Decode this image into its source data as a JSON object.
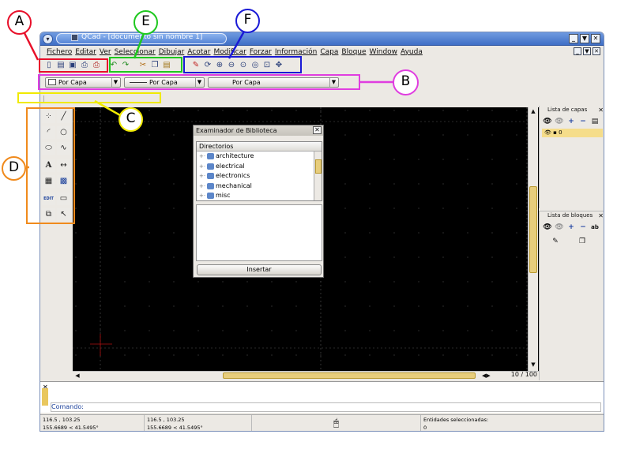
{
  "window": {
    "title": "QCad - [documento sin nombre 1]",
    "colors": {
      "titlebar": "#4f7fd0",
      "canvas": "#000000",
      "accent": "#e7cd7c"
    }
  },
  "menu": [
    "Fichero",
    "Editar",
    "Ver",
    "Seleccionar",
    "Dibujar",
    "Acotar",
    "Modificar",
    "Forzar",
    "Información",
    "Capa",
    "Bloque",
    "Window",
    "Ayuda"
  ],
  "toolbars": {
    "file_icons": [
      "new-icon",
      "open-icon",
      "save-icon",
      "print-icon",
      "print-preview-icon"
    ],
    "edit_icons": [
      "undo-icon",
      "redo-icon",
      "cut-icon",
      "copy-icon",
      "paste-icon"
    ],
    "view_icons": [
      "grid-icon",
      "draft-icon",
      "redraw-icon",
      "zoom-in-icon",
      "zoom-out-icon",
      "zoom-auto-icon",
      "zoom-previous-icon",
      "zoom-window-icon",
      "pan-icon"
    ]
  },
  "pen": {
    "color": "Por Capa",
    "width": "Por Capa",
    "linetype": "Por Capa"
  },
  "library": {
    "title": "Examinador de Biblioteca",
    "header": "Directorios",
    "items": [
      "architecture",
      "electrical",
      "electronics",
      "mechanical",
      "misc"
    ],
    "insert_label": "Insertar"
  },
  "layers": {
    "title": "Lista de capas",
    "items": [
      "0"
    ]
  },
  "blocks": {
    "title": "Lista de bloques"
  },
  "page_counter": "10 / 100",
  "command": {
    "label": "Comando:"
  },
  "status": {
    "abs_coords": "116.5 , 103.25",
    "abs_polar": "155.6689 < 41.5495°",
    "rel_coords": "116.5 , 103.25",
    "rel_polar": "155.6689 < 41.5495°",
    "selected_label": "Entidades seleccionadas:",
    "selected_count": "0"
  },
  "palette_edit_label": "EDIT",
  "annotations": {
    "A": {
      "label": "A",
      "color": "#e8102a"
    },
    "B": {
      "label": "B",
      "color": "#e03de0"
    },
    "C": {
      "label": "C",
      "color": "#f0ea00"
    },
    "D": {
      "label": "D",
      "color": "#f08a1c"
    },
    "E": {
      "label": "E",
      "color": "#1fc81f"
    },
    "F": {
      "label": "F",
      "color": "#1a1ad6"
    }
  }
}
